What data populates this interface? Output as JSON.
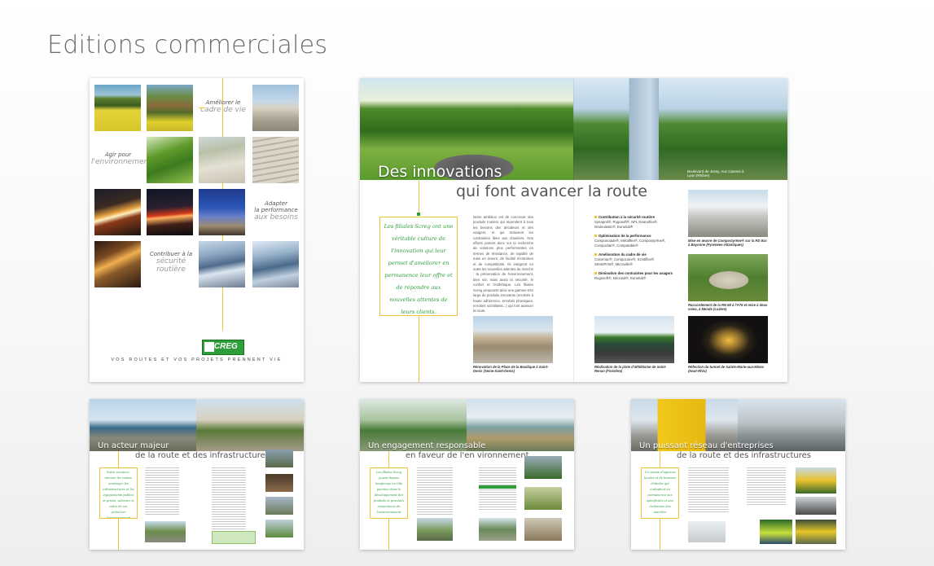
{
  "title": "Editions commerciales",
  "colors": {
    "accent_yellow": "#f1c232",
    "brand_green": "#2e9e3a",
    "title_grey": "#6a6a6a"
  },
  "cover": {
    "caption_1": {
      "line1": "Améliorer le",
      "line2": "cadre de vie"
    },
    "caption_2": {
      "line1": "Agir pour",
      "line2": "l'environnement"
    },
    "caption_3": {
      "line1": "Adapter",
      "line1b": "la performance",
      "line2": "aux besoins"
    },
    "caption_4": {
      "line1": "Contribuer à la",
      "line2": "sécurité",
      "line3": "routière"
    },
    "logo_text": "SCREG",
    "tagline": "Vos routes et vos projets prennent vie"
  },
  "spread": {
    "title_line1": "Des innovations",
    "title_line2": "qui font avancer  la route",
    "hero_caption": "Boulevard de Jussy, Aux Cannes à Lyon (Rhône)",
    "quote": "Les filiales Screg ont une véritable culture de l'innovation qui leur permet d'améliorer en permanence leur offre et de répondre aux nouvelles attentes de leurs clients.",
    "body": "Notre ambition est de concevoir des produits routiers qui répondent à tous les besoins des décideurs et des usagers, et qui réduisent les contraintes liées aux chantiers. Nos efforts portent donc sur la recherche de solutions plus performantes en termes de résistance, de rapidité de mise en œuvre, de facilité d'entretien et de compétitivité. Ils intègrent en outre les nouvelles attentes du marché : la préservation de l'environnement, bien sûr, mais aussi la sécurité, le confort et l'esthétique. Les filiales Screg proposent ainsi une gamme très large de produits innovants (enrobés à haute adhérence, enrobés phoniques, enrobés scintillants...) qui font avancer la route.",
    "bullets": [
      {
        "head": "Contribution à la sécurité routière",
        "text": "Synaprol®, Rugosoft®, NFL Drainoflex®, Drainolastic®, Euroduit®"
      },
      {
        "head": "Optimisation de la performance",
        "text": "Componodule®, Métalflex®, Compostyrène®, Compoclair®, Compotable®"
      },
      {
        "head": "Amélioration du cadre de vie",
        "text": "Colormac®, Compocolor®, Scintiflex®, StreetPrint®, Microville®"
      },
      {
        "head": "Diminution des contraintes pour les usagers",
        "text": "Rugosoft®, Néocéal®, Euroduit®"
      }
    ],
    "captions": {
      "right_1": "Mise en œuvre de Compostyrène® sur la RD 8xx à Bayonne (Pyrénées-Atlantiques)",
      "right_2": "Raccordement de la RN 88 à l'A75 et mise à deux voies, à Mende (Lozère)",
      "right_3": "Réfection du tunnel de Sainte-Marie-aux-Mines (Haut-Rhin)",
      "bottom_1": "Rénovation de la Place de la Basilique à Saint-Denis (Seine-Saint-Denis)",
      "bottom_2": "Réalisation de la piste d'athlétisme de Saint-Renan (Finistère)"
    }
  },
  "thumbs": [
    {
      "title_a": "Un acteur majeur",
      "title_b": "de la route et des  infrastructures",
      "quote": "Notre vocation : rénover les routes, aménager les infrastructures et les équipements publics et privés, valoriser le cadre de vie, préserver l'environnement"
    },
    {
      "title_a": "Un engagement responsable",
      "title_b": "en faveur de l'en vironnement",
      "quote": "Les filiales Screg jouent depuis longtemps un rôle pionnier dans le développement des produits et procédés respectueux de l'environnement"
    },
    {
      "title_a": "Un puissant réseau d'entreprises",
      "title_b": "de la route et des  infrastructures",
      "quote": "Un réseau d'agences locales et de bureaux d'études qui s'adaptent en permanence aux spécificités et aux évolutions des marchés"
    }
  ]
}
